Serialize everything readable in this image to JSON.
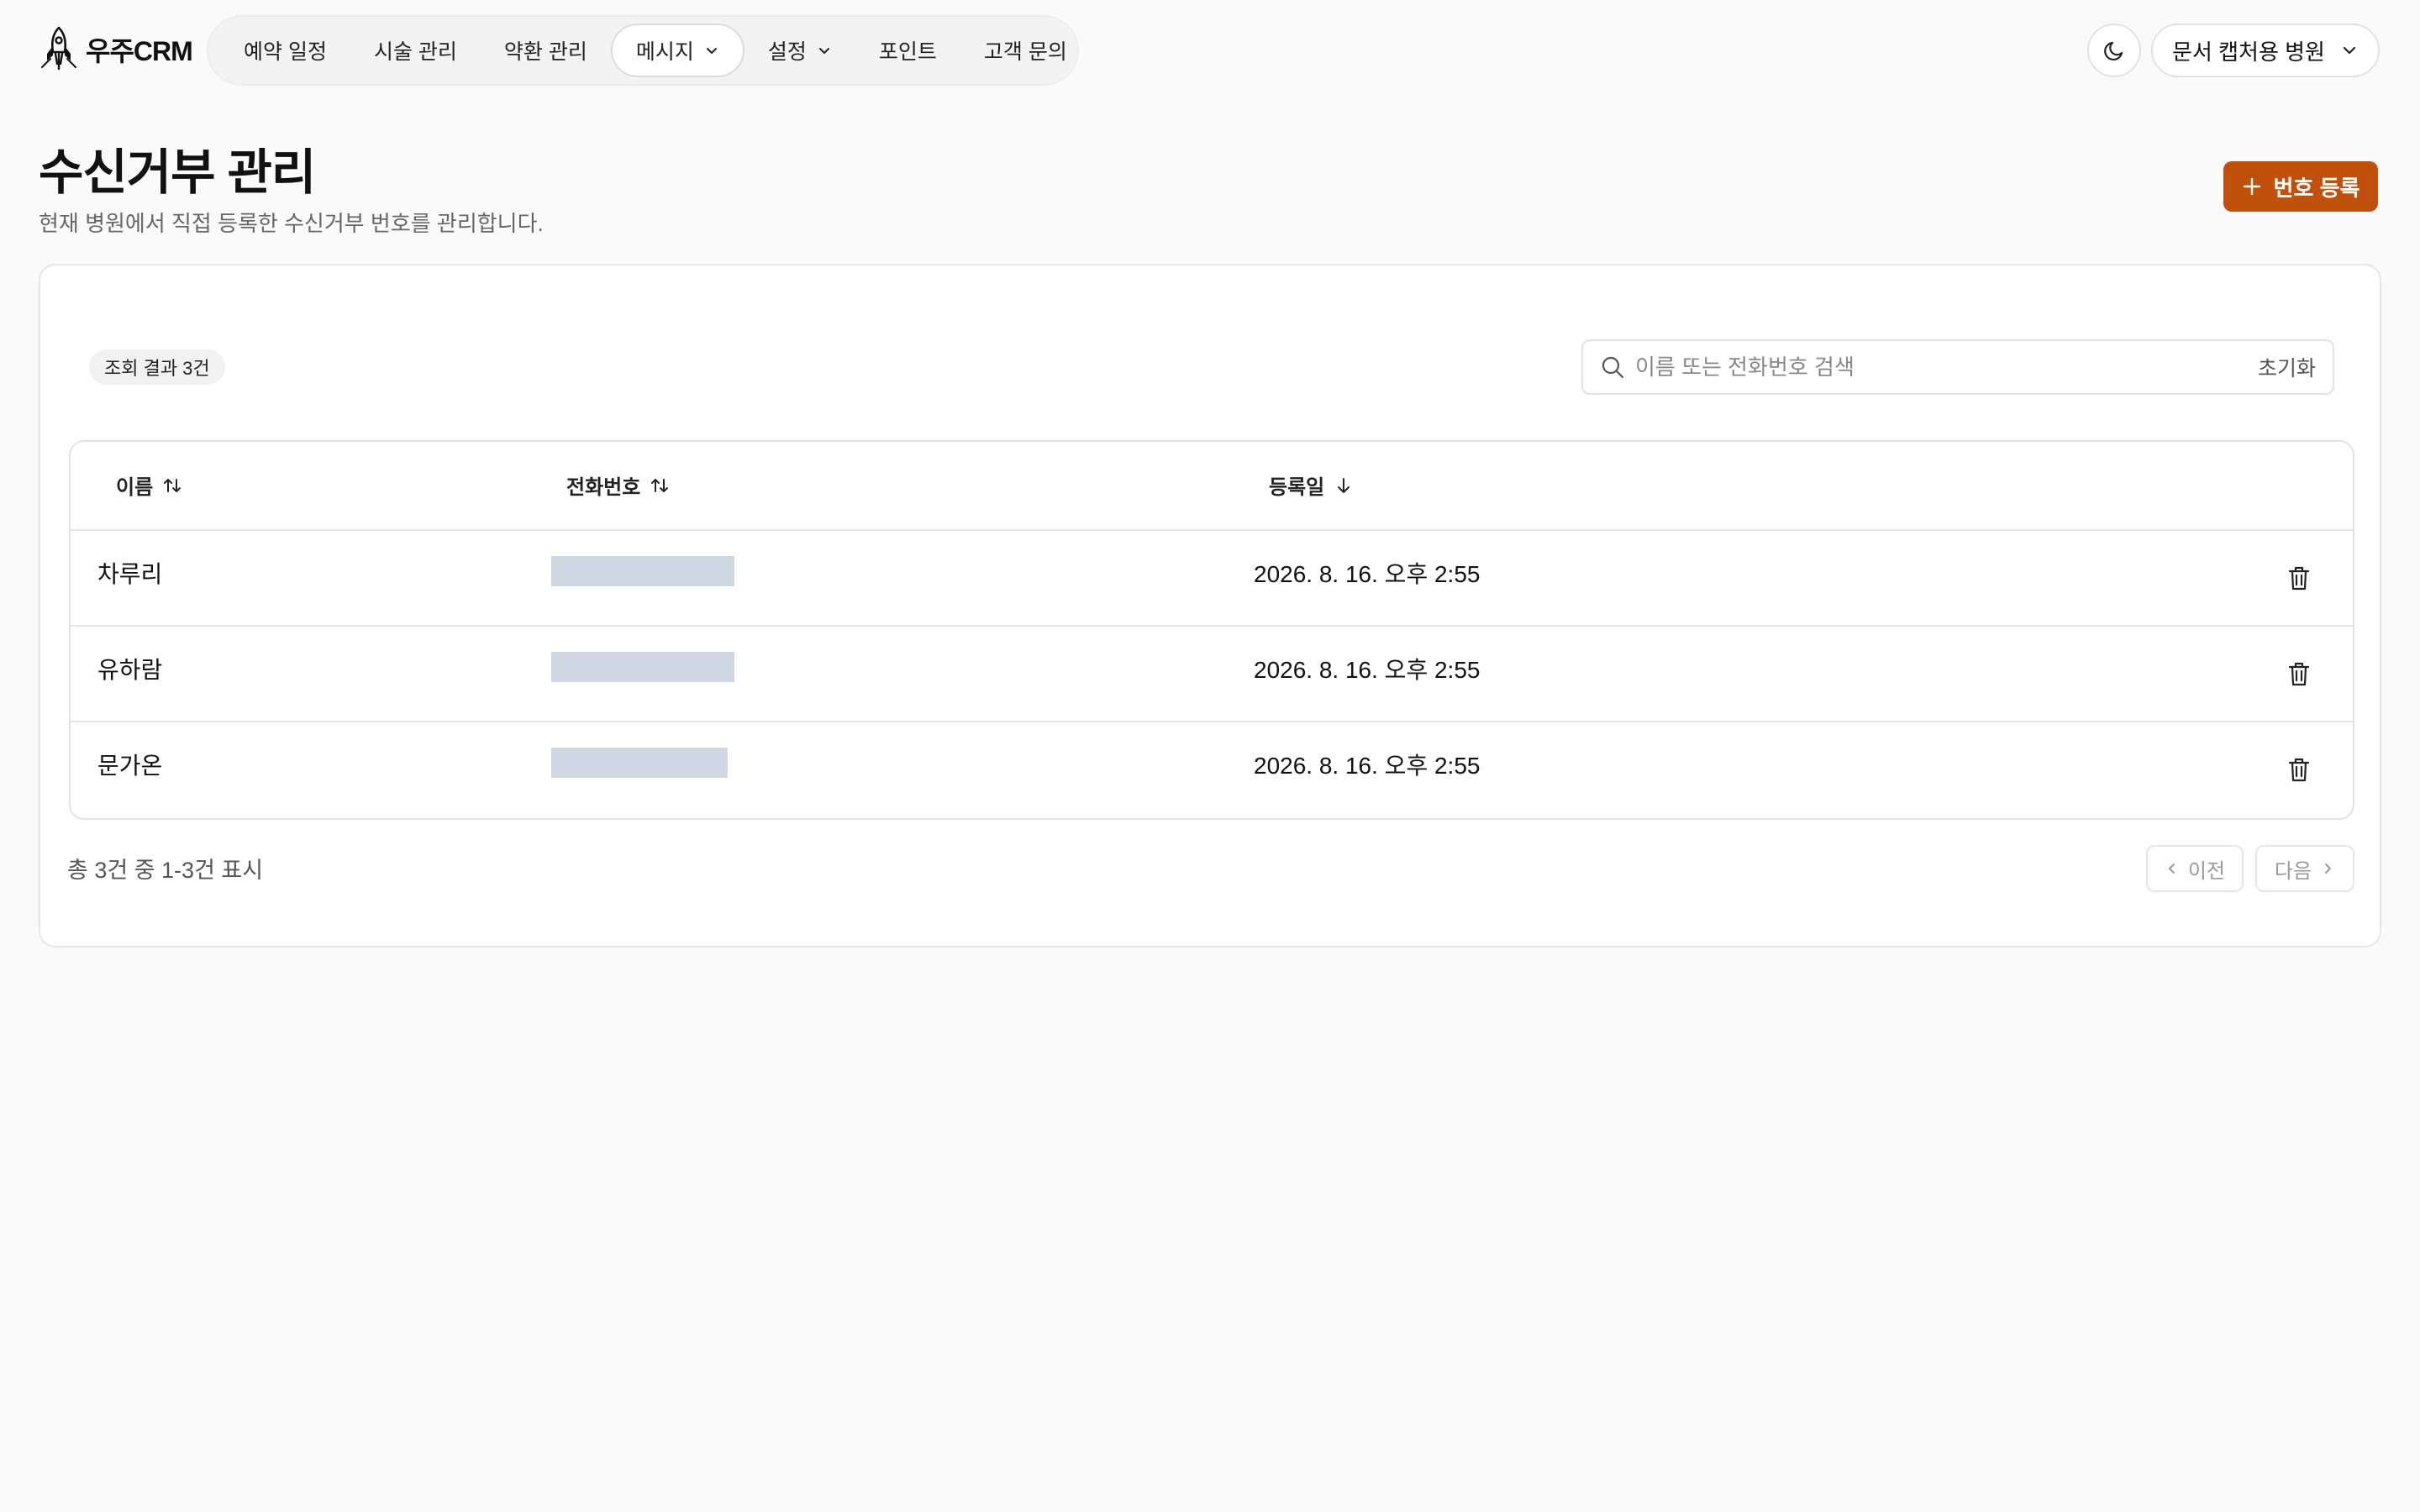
{
  "app": {
    "logo_text": "우주CRM"
  },
  "nav": {
    "items": [
      {
        "label": "예약 일정",
        "dropdown": false,
        "active": false
      },
      {
        "label": "시술 관리",
        "dropdown": false,
        "active": false
      },
      {
        "label": "약환 관리",
        "dropdown": false,
        "active": false
      },
      {
        "label": "메시지",
        "dropdown": true,
        "active": true
      },
      {
        "label": "설정",
        "dropdown": true,
        "active": false
      },
      {
        "label": "포인트",
        "dropdown": false,
        "active": false
      },
      {
        "label": "고객 문의",
        "dropdown": false,
        "active": false
      }
    ]
  },
  "header": {
    "theme_icon": "moon-icon",
    "clinic_label": "문서 캡처용 병원"
  },
  "page": {
    "title": "수신거부 관리",
    "subtitle": "현재 병원에서 직접 등록한 수신거부 번호를 관리합니다.",
    "add_button": "번호 등록"
  },
  "toolbar": {
    "result_count": "조회 결과 3건",
    "search_placeholder": "이름 또는 전화번호 검색",
    "reset_label": "초기화"
  },
  "table": {
    "columns": [
      {
        "label": "이름",
        "sort_icon": "sort-both-icon"
      },
      {
        "label": "전화번호",
        "sort_icon": "sort-both-icon"
      },
      {
        "label": "등록일",
        "sort_icon": "sort-desc-icon"
      }
    ],
    "rows": [
      {
        "name": "차루리",
        "phone_masked": true,
        "registered": "2026. 8. 16. 오후 2:55"
      },
      {
        "name": "유하람",
        "phone_masked": true,
        "registered": "2026. 8. 16. 오후 2:55"
      },
      {
        "name": "문가온",
        "phone_masked": true,
        "registered": "2026. 8. 16. 오후 2:55"
      }
    ]
  },
  "pagination": {
    "summary": "총 3건 중 1-3건 표시",
    "prev_label": "이전",
    "next_label": "다음"
  },
  "colors": {
    "accent": "#c2500d",
    "mask": "#cfd8e3",
    "background": "#fafafa"
  }
}
